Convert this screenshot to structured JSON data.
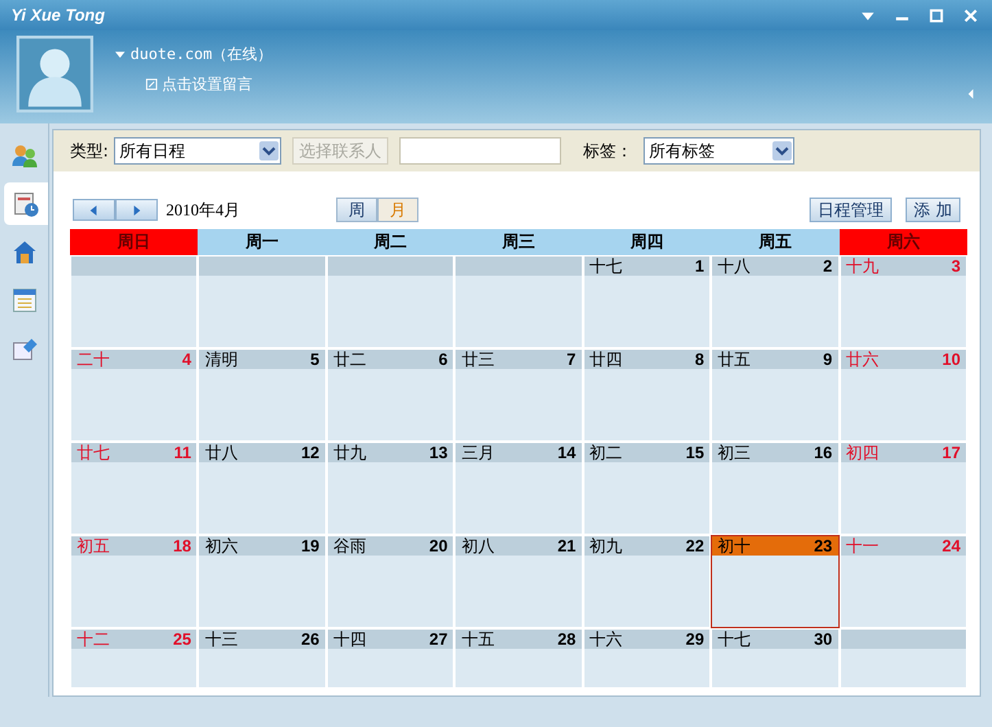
{
  "window": {
    "title": "Yi Xue Tong"
  },
  "profile": {
    "account": "duote.com（在线）",
    "message_prompt": "点击设置留言"
  },
  "sidebar": {
    "items": [
      {
        "selected": false
      },
      {
        "selected": true
      },
      {
        "selected": false
      },
      {
        "selected": false
      },
      {
        "selected": false
      }
    ]
  },
  "filters": {
    "type_label": "类型:",
    "type_value": "所有日程",
    "contact_button": "选择联系人",
    "tag_label": "标签：",
    "tag_value": "所有标签"
  },
  "calendar": {
    "month": "2010年4月",
    "views": [
      {
        "label": "周",
        "selected": false
      },
      {
        "label": "月",
        "selected": true
      }
    ],
    "buttons": [
      "日程管理",
      "添 加"
    ],
    "weekdays": [
      {
        "label": "周日",
        "weekend": true
      },
      {
        "label": "周一",
        "weekend": false
      },
      {
        "label": "周二",
        "weekend": false
      },
      {
        "label": "周三",
        "weekend": false
      },
      {
        "label": "周四",
        "weekend": false
      },
      {
        "label": "周五",
        "weekend": false
      },
      {
        "label": "周六",
        "weekend": true
      }
    ],
    "weeks": [
      [
        {
          "kind": "blank"
        },
        {
          "kind": "blank"
        },
        {
          "kind": "blank"
        },
        {
          "kind": "blank"
        },
        {
          "lunar": "十七",
          "day": "1",
          "selected": false
        },
        {
          "lunar": "十八",
          "day": "2",
          "selected": false
        },
        {
          "lunar": "十九",
          "day": "3",
          "selected": false
        }
      ],
      [
        {
          "lunar": "二十",
          "day": "4",
          "selected": false
        },
        {
          "lunar": "清明",
          "day": "5",
          "selected": false
        },
        {
          "lunar": "廿二",
          "day": "6",
          "selected": false
        },
        {
          "lunar": "廿三",
          "day": "7",
          "selected": false
        },
        {
          "lunar": "廿四",
          "day": "8",
          "selected": false
        },
        {
          "lunar": "廿五",
          "day": "9",
          "selected": false
        },
        {
          "lunar": "廿六",
          "day": "10",
          "selected": false
        }
      ],
      [
        {
          "lunar": "廿七",
          "day": "11",
          "selected": false
        },
        {
          "lunar": "廿八",
          "day": "12",
          "selected": false
        },
        {
          "lunar": "廿九",
          "day": "13",
          "selected": false
        },
        {
          "lunar": "三月",
          "day": "14",
          "selected": false
        },
        {
          "lunar": "初二",
          "day": "15",
          "selected": false
        },
        {
          "lunar": "初三",
          "day": "16",
          "selected": false
        },
        {
          "lunar": "初四",
          "day": "17",
          "selected": false
        }
      ],
      [
        {
          "lunar": "初五",
          "day": "18",
          "selected": false
        },
        {
          "lunar": "初六",
          "day": "19",
          "selected": false
        },
        {
          "lunar": "谷雨",
          "day": "20",
          "selected": false
        },
        {
          "lunar": "初八",
          "day": "21",
          "selected": false
        },
        {
          "lunar": "初九",
          "day": "22",
          "selected": false
        },
        {
          "lunar": "初十",
          "day": "23",
          "selected": true
        },
        {
          "lunar": "十一",
          "day": "24",
          "selected": false
        }
      ],
      [
        {
          "lunar": "十二",
          "day": "25",
          "selected": false
        },
        {
          "lunar": "十三",
          "day": "26",
          "selected": false
        },
        {
          "lunar": "十四",
          "day": "27",
          "selected": false
        },
        {
          "lunar": "十五",
          "day": "28",
          "selected": false
        },
        {
          "lunar": "十六",
          "day": "29",
          "selected": false
        },
        {
          "lunar": "十七",
          "day": "30",
          "selected": false
        },
        {
          "kind": "blank"
        }
      ]
    ]
  }
}
